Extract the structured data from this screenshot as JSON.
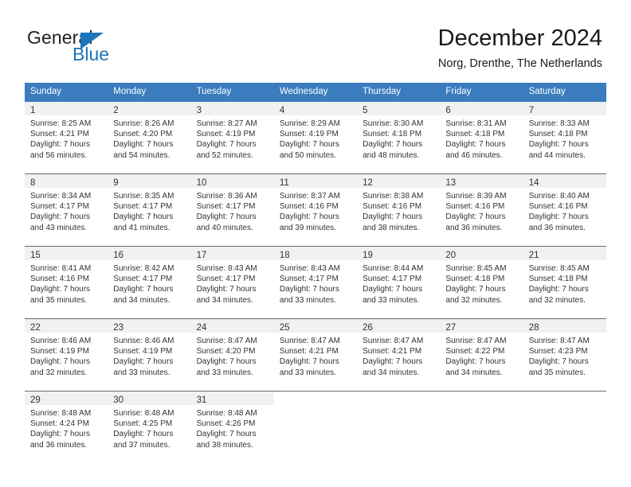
{
  "brand": {
    "name_part1": "General",
    "name_part2": "Blue",
    "triangle_color": "#1b75bb",
    "text_color": "#231f20"
  },
  "header": {
    "title": "December 2024",
    "subtitle": "Norg, Drenthe, The Netherlands"
  },
  "calendar": {
    "header_bg": "#3a7cbe",
    "header_text_color": "#ffffff",
    "daynum_bg": "#f1f1f1",
    "weekdays": [
      "Sunday",
      "Monday",
      "Tuesday",
      "Wednesday",
      "Thursday",
      "Friday",
      "Saturday"
    ],
    "weeks": [
      [
        {
          "day": "1",
          "sunrise": "Sunrise: 8:25 AM",
          "sunset": "Sunset: 4:21 PM",
          "daylight1": "Daylight: 7 hours",
          "daylight2": "and 56 minutes."
        },
        {
          "day": "2",
          "sunrise": "Sunrise: 8:26 AM",
          "sunset": "Sunset: 4:20 PM",
          "daylight1": "Daylight: 7 hours",
          "daylight2": "and 54 minutes."
        },
        {
          "day": "3",
          "sunrise": "Sunrise: 8:27 AM",
          "sunset": "Sunset: 4:19 PM",
          "daylight1": "Daylight: 7 hours",
          "daylight2": "and 52 minutes."
        },
        {
          "day": "4",
          "sunrise": "Sunrise: 8:29 AM",
          "sunset": "Sunset: 4:19 PM",
          "daylight1": "Daylight: 7 hours",
          "daylight2": "and 50 minutes."
        },
        {
          "day": "5",
          "sunrise": "Sunrise: 8:30 AM",
          "sunset": "Sunset: 4:18 PM",
          "daylight1": "Daylight: 7 hours",
          "daylight2": "and 48 minutes."
        },
        {
          "day": "6",
          "sunrise": "Sunrise: 8:31 AM",
          "sunset": "Sunset: 4:18 PM",
          "daylight1": "Daylight: 7 hours",
          "daylight2": "and 46 minutes."
        },
        {
          "day": "7",
          "sunrise": "Sunrise: 8:33 AM",
          "sunset": "Sunset: 4:18 PM",
          "daylight1": "Daylight: 7 hours",
          "daylight2": "and 44 minutes."
        }
      ],
      [
        {
          "day": "8",
          "sunrise": "Sunrise: 8:34 AM",
          "sunset": "Sunset: 4:17 PM",
          "daylight1": "Daylight: 7 hours",
          "daylight2": "and 43 minutes."
        },
        {
          "day": "9",
          "sunrise": "Sunrise: 8:35 AM",
          "sunset": "Sunset: 4:17 PM",
          "daylight1": "Daylight: 7 hours",
          "daylight2": "and 41 minutes."
        },
        {
          "day": "10",
          "sunrise": "Sunrise: 8:36 AM",
          "sunset": "Sunset: 4:17 PM",
          "daylight1": "Daylight: 7 hours",
          "daylight2": "and 40 minutes."
        },
        {
          "day": "11",
          "sunrise": "Sunrise: 8:37 AM",
          "sunset": "Sunset: 4:16 PM",
          "daylight1": "Daylight: 7 hours",
          "daylight2": "and 39 minutes."
        },
        {
          "day": "12",
          "sunrise": "Sunrise: 8:38 AM",
          "sunset": "Sunset: 4:16 PM",
          "daylight1": "Daylight: 7 hours",
          "daylight2": "and 38 minutes."
        },
        {
          "day": "13",
          "sunrise": "Sunrise: 8:39 AM",
          "sunset": "Sunset: 4:16 PM",
          "daylight1": "Daylight: 7 hours",
          "daylight2": "and 36 minutes."
        },
        {
          "day": "14",
          "sunrise": "Sunrise: 8:40 AM",
          "sunset": "Sunset: 4:16 PM",
          "daylight1": "Daylight: 7 hours",
          "daylight2": "and 36 minutes."
        }
      ],
      [
        {
          "day": "15",
          "sunrise": "Sunrise: 8:41 AM",
          "sunset": "Sunset: 4:16 PM",
          "daylight1": "Daylight: 7 hours",
          "daylight2": "and 35 minutes."
        },
        {
          "day": "16",
          "sunrise": "Sunrise: 8:42 AM",
          "sunset": "Sunset: 4:17 PM",
          "daylight1": "Daylight: 7 hours",
          "daylight2": "and 34 minutes."
        },
        {
          "day": "17",
          "sunrise": "Sunrise: 8:43 AM",
          "sunset": "Sunset: 4:17 PM",
          "daylight1": "Daylight: 7 hours",
          "daylight2": "and 34 minutes."
        },
        {
          "day": "18",
          "sunrise": "Sunrise: 8:43 AM",
          "sunset": "Sunset: 4:17 PM",
          "daylight1": "Daylight: 7 hours",
          "daylight2": "and 33 minutes."
        },
        {
          "day": "19",
          "sunrise": "Sunrise: 8:44 AM",
          "sunset": "Sunset: 4:17 PM",
          "daylight1": "Daylight: 7 hours",
          "daylight2": "and 33 minutes."
        },
        {
          "day": "20",
          "sunrise": "Sunrise: 8:45 AM",
          "sunset": "Sunset: 4:18 PM",
          "daylight1": "Daylight: 7 hours",
          "daylight2": "and 32 minutes."
        },
        {
          "day": "21",
          "sunrise": "Sunrise: 8:45 AM",
          "sunset": "Sunset: 4:18 PM",
          "daylight1": "Daylight: 7 hours",
          "daylight2": "and 32 minutes."
        }
      ],
      [
        {
          "day": "22",
          "sunrise": "Sunrise: 8:46 AM",
          "sunset": "Sunset: 4:19 PM",
          "daylight1": "Daylight: 7 hours",
          "daylight2": "and 32 minutes."
        },
        {
          "day": "23",
          "sunrise": "Sunrise: 8:46 AM",
          "sunset": "Sunset: 4:19 PM",
          "daylight1": "Daylight: 7 hours",
          "daylight2": "and 33 minutes."
        },
        {
          "day": "24",
          "sunrise": "Sunrise: 8:47 AM",
          "sunset": "Sunset: 4:20 PM",
          "daylight1": "Daylight: 7 hours",
          "daylight2": "and 33 minutes."
        },
        {
          "day": "25",
          "sunrise": "Sunrise: 8:47 AM",
          "sunset": "Sunset: 4:21 PM",
          "daylight1": "Daylight: 7 hours",
          "daylight2": "and 33 minutes."
        },
        {
          "day": "26",
          "sunrise": "Sunrise: 8:47 AM",
          "sunset": "Sunset: 4:21 PM",
          "daylight1": "Daylight: 7 hours",
          "daylight2": "and 34 minutes."
        },
        {
          "day": "27",
          "sunrise": "Sunrise: 8:47 AM",
          "sunset": "Sunset: 4:22 PM",
          "daylight1": "Daylight: 7 hours",
          "daylight2": "and 34 minutes."
        },
        {
          "day": "28",
          "sunrise": "Sunrise: 8:47 AM",
          "sunset": "Sunset: 4:23 PM",
          "daylight1": "Daylight: 7 hours",
          "daylight2": "and 35 minutes."
        }
      ],
      [
        {
          "day": "29",
          "sunrise": "Sunrise: 8:48 AM",
          "sunset": "Sunset: 4:24 PM",
          "daylight1": "Daylight: 7 hours",
          "daylight2": "and 36 minutes."
        },
        {
          "day": "30",
          "sunrise": "Sunrise: 8:48 AM",
          "sunset": "Sunset: 4:25 PM",
          "daylight1": "Daylight: 7 hours",
          "daylight2": "and 37 minutes."
        },
        {
          "day": "31",
          "sunrise": "Sunrise: 8:48 AM",
          "sunset": "Sunset: 4:26 PM",
          "daylight1": "Daylight: 7 hours",
          "daylight2": "and 38 minutes."
        },
        {
          "day": "",
          "sunrise": "",
          "sunset": "",
          "daylight1": "",
          "daylight2": ""
        },
        {
          "day": "",
          "sunrise": "",
          "sunset": "",
          "daylight1": "",
          "daylight2": ""
        },
        {
          "day": "",
          "sunrise": "",
          "sunset": "",
          "daylight1": "",
          "daylight2": ""
        },
        {
          "day": "",
          "sunrise": "",
          "sunset": "",
          "daylight1": "",
          "daylight2": ""
        }
      ]
    ]
  }
}
